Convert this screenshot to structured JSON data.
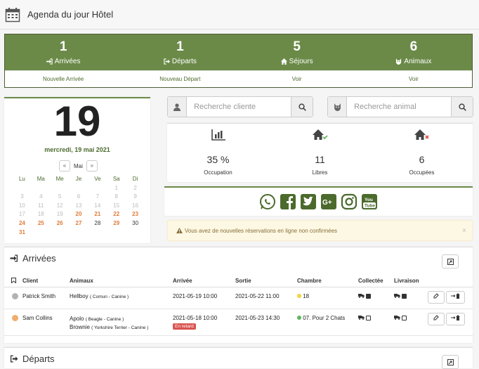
{
  "header": {
    "title": "Agenda du jour Hôtel"
  },
  "stats": [
    {
      "count": "1",
      "label": "Arrivées",
      "icon": "sign-in-icon",
      "link": "Nouvelle Arrivée"
    },
    {
      "count": "1",
      "label": "Départs",
      "icon": "sign-out-icon",
      "link": "Nouveau Départ"
    },
    {
      "count": "5",
      "label": "Séjours",
      "icon": "home-icon",
      "link": "Voir"
    },
    {
      "count": "6",
      "label": "Animaux",
      "icon": "cat-icon",
      "link": "Voir"
    }
  ],
  "calendar": {
    "day": "19",
    "date_text": "mercredi, 19 mai 2021",
    "month": "Mai",
    "prev": "«",
    "next": "»",
    "weekdays": [
      "Lu",
      "Ma",
      "Me",
      "Je",
      "Ve",
      "Sa",
      "Di"
    ],
    "weeks": [
      [
        "",
        "",
        "",
        "",
        "",
        "1",
        "2"
      ],
      [
        "3",
        "4",
        "5",
        "6",
        "7",
        "8",
        "9"
      ],
      [
        "10",
        "11",
        "12",
        "13",
        "14",
        "15",
        "16"
      ],
      [
        "17",
        "18",
        "19",
        "20",
        "21",
        "22",
        "23"
      ],
      [
        "24",
        "25",
        "26",
        "27",
        "28",
        "29",
        "30"
      ],
      [
        "31",
        "",
        "",
        "",
        "",
        "",
        ""
      ]
    ]
  },
  "search": {
    "client_placeholder": "Recherche cliente",
    "animal_placeholder": "Recherche animal"
  },
  "occupation": [
    {
      "value": "35 %",
      "label": "Occupation",
      "icon": "bar-chart-icon"
    },
    {
      "value": "11",
      "label": "Libres",
      "icon": "home-check-icon"
    },
    {
      "value": "6",
      "label": "Occupées",
      "icon": "home-x-icon"
    }
  ],
  "social": [
    "whatsapp-icon",
    "facebook-icon",
    "twitter-icon",
    "google-plus-icon",
    "instagram-icon",
    "youtube-icon"
  ],
  "alert": {
    "text": "Vous avez de nouvelles réservations en ligne non confirmées",
    "close": "×"
  },
  "arrivals": {
    "title": "Arrivées",
    "columns": [
      "",
      "Client",
      "Animaux",
      "Arrivée",
      "Sortie",
      "Chambre",
      "Collectée",
      "Livraison",
      ""
    ],
    "rows": [
      {
        "client": "Patrick Smith",
        "status_color": "#b3b3b3",
        "animals": [
          {
            "name": "Hellboy",
            "breed": "( Comun - Canine )"
          }
        ],
        "arrival": "2021-05-19 10:00",
        "late": "",
        "departure": "2021-05-22 11:00",
        "room": "18",
        "room_color": "#f0d33c",
        "collected": true,
        "delivery": true
      },
      {
        "client": "Sam Collins",
        "status_color": "#f0ad6e",
        "animals": [
          {
            "name": "Apolo",
            "breed": "( Beagle - Canine )"
          },
          {
            "name": "Brownie",
            "breed": "( Yorkshire Terrier - Canine )"
          }
        ],
        "arrival": "2021-05-18 10:00",
        "late": "En retard",
        "departure": "2021-05-23 14:30",
        "room": "07. Pour 2 Chats",
        "room_color": "#5cb85c",
        "collected": false,
        "delivery": false
      }
    ]
  },
  "departures": {
    "title": "Départs"
  }
}
